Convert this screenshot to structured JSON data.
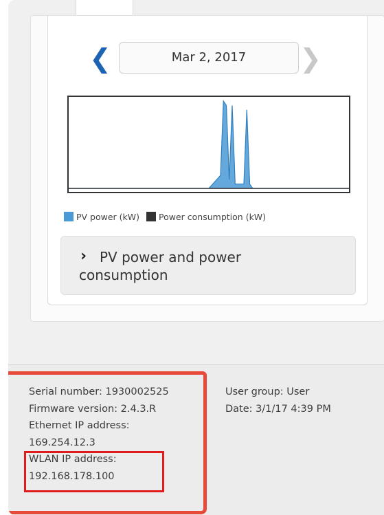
{
  "navigation": {
    "prev_icon": "chevron-left-icon",
    "next_icon": "chevron-right-icon",
    "prev_glyph": "❮",
    "next_glyph": "❯",
    "date": "Mar 2, 2017"
  },
  "chart_data": {
    "type": "area",
    "series": [
      {
        "name": "PV power (kW)",
        "color": "#4a9ad6",
        "x": [
          "00:00",
          "12:00",
          "13:00",
          "13:15",
          "13:30",
          "13:45",
          "14:00",
          "14:15",
          "14:30",
          "15:00",
          "15:15",
          "15:30",
          "15:45",
          "16:00",
          "24:00"
        ],
        "values": [
          0,
          0,
          0.15,
          1.0,
          0.95,
          0.1,
          0.95,
          0.05,
          0.05,
          0.05,
          0.9,
          0.05,
          0,
          0,
          0
        ]
      },
      {
        "name": "Power consumption (kW)",
        "color": "#333333",
        "x": [
          "00:00",
          "24:00"
        ],
        "values": [
          0,
          0
        ]
      }
    ],
    "title": "",
    "xlabel": "",
    "ylabel": "",
    "grid": false,
    "legend": "bottom-left"
  },
  "legend": {
    "pv_label": "PV power (kW)",
    "consumption_label": "Power consumption (kW)"
  },
  "accordion": {
    "icon": "chevron-right-icon",
    "glyph": "›",
    "title": "PV power and power consumption"
  },
  "device_info": {
    "serial": "Serial number: 1930002525",
    "firmware": "Firmware version: 2.4.3.R",
    "ethernet_label": "Ethernet IP address:",
    "ethernet_ip": "169.254.12.3",
    "wlan_label": "WLAN IP address:",
    "wlan_ip": "192.168.178.100",
    "user_group": "User group: User",
    "date": "Date: 3/1/17 4:39 PM"
  },
  "colors": {
    "accent": "#1e64b4",
    "highlight": "#e84a3a",
    "highlight_inner": "#e01b1b"
  }
}
